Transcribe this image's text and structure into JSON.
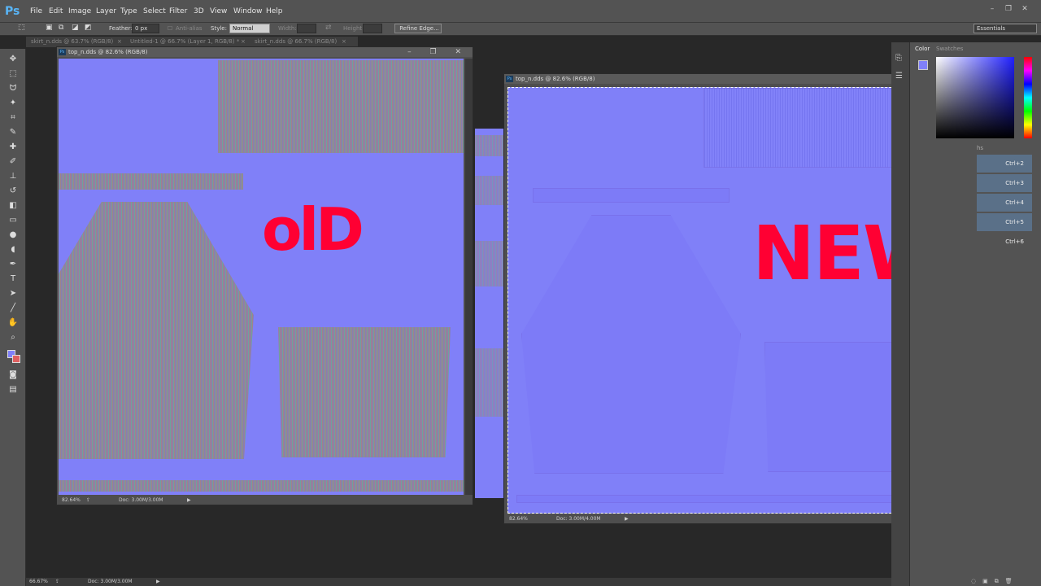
{
  "app": {
    "logo": "Ps"
  },
  "menu": [
    "File",
    "Edit",
    "Image",
    "Layer",
    "Type",
    "Select",
    "Filter",
    "3D",
    "View",
    "Window",
    "Help"
  ],
  "options": {
    "feather_label": "Feather:",
    "feather_value": "0 px",
    "antialias": "Anti-alias",
    "style_label": "Style:",
    "style_value": "Normal",
    "width_label": "Width:",
    "height_label": "Height:",
    "refine": "Refine Edge...",
    "workspace": "Essentials"
  },
  "tabs": [
    "skirt_n.dds @ 63.7% (RGB/8)",
    "Untitled-1 @ 66.7% (Layer 1, RGB/8) *",
    "skirt_n.dds @ 66.7% (RGB/8)"
  ],
  "doc_left": {
    "title": "top_n.dds @ 82.6% (RGB/8)",
    "zoom": "82.64%",
    "doc": "Doc: 3.00M/3.00M",
    "handwriting": "olD"
  },
  "doc_right": {
    "title": "top_n.dds @ 82.6% (RGB/8)",
    "zoom": "82.64%",
    "doc": "Doc: 3.00M/4.00M",
    "handwriting": "NEW"
  },
  "panel": {
    "color_tab": "Color",
    "swatches_tab": "Swatches",
    "shortcuts": [
      "Ctrl+2",
      "Ctrl+3",
      "Ctrl+4",
      "Ctrl+5",
      "Ctrl+6"
    ],
    "hs": "hs"
  },
  "status": {
    "zoom": "66.67%",
    "doc": "Doc: 3.00M/3.00M"
  },
  "colors": {
    "normal_map": "#8080f8",
    "annotation": "#ff0033",
    "chrome": "#535353"
  }
}
